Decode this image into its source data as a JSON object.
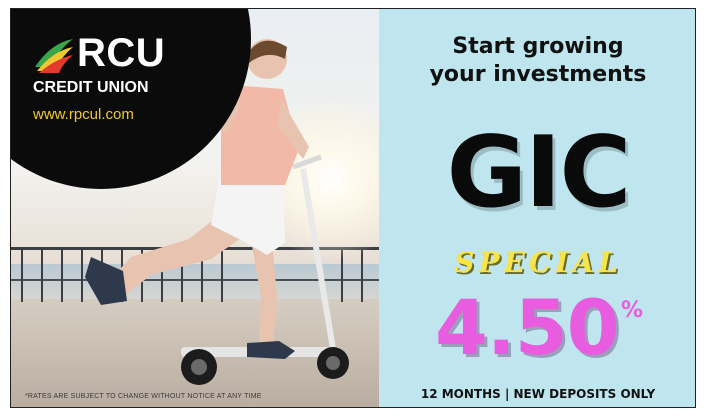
{
  "brand": {
    "name": "RCU",
    "subtitle": "CREDIT UNION",
    "url": "www.rpcul.com",
    "colors": {
      "gold": "#f2c832",
      "green": "#3aa64a",
      "black": "#0b0b0b"
    }
  },
  "photo": {
    "disclaimer": "*RATES ARE SUBJECT TO CHANGE WITHOUT NOTICE AT ANY TIME"
  },
  "offer": {
    "headline_line1": "Start growing",
    "headline_line2": "your investments",
    "product": "GIC",
    "special": "SPECIAL",
    "rate": "4.50",
    "rate_unit": "%",
    "terms": "12 MONTHS  | NEW DEPOSITS ONLY",
    "colors": {
      "panel": "#bfe6ee",
      "rate": "#e85ce0",
      "special": "#f7e34a"
    }
  }
}
